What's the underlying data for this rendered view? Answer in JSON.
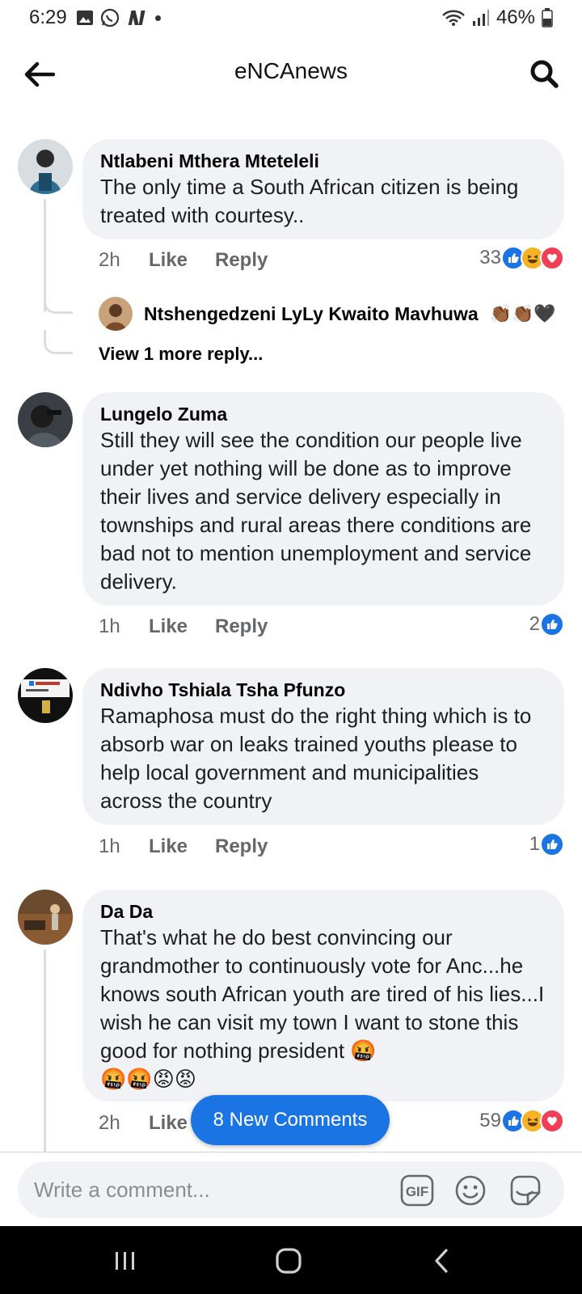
{
  "status": {
    "time": "6:29",
    "battery": "46%"
  },
  "header": {
    "title": "eNCAnews"
  },
  "comments": [
    {
      "author": "Ntlabeni Mthera Mteteleli",
      "text": "The only time a South African citizen is being treated with courtesy..",
      "time": "2h",
      "like": "Like",
      "reply": "Reply",
      "reaction_count": "33",
      "reactions": [
        "like-icon",
        "haha-icon",
        "love-icon"
      ],
      "reply_preview": {
        "author": "Ntshengedzeni LyLy Kwaito Mavhuwa",
        "emoji": "👏🏾👏🏾🖤"
      },
      "view_more": "View 1 more reply..."
    },
    {
      "author": "Lungelo Zuma",
      "text": "Still they will see the condition our people live under yet nothing will be done as to improve their lives and service delivery especially in townships and rural areas there conditions are bad not to mention unemployment and service delivery.",
      "time": "1h",
      "like": "Like",
      "reply": "Reply",
      "reaction_count": "2",
      "reactions": [
        "like-icon"
      ]
    },
    {
      "author": "Ndivho Tshiala Tsha Pfunzo",
      "text": "Ramaphosa must do the right thing which is to absorb war on leaks trained youths please to help local government and municipalities across the country",
      "time": "1h",
      "like": "Like",
      "reply": "Reply",
      "reaction_count": "1",
      "reactions": [
        "like-icon"
      ]
    },
    {
      "author": "Da Da",
      "text": "That's what he do best convincing our grandmother to continuously vote for Anc...he knows south African youth are tired of his lies...I wish he can visit my town I want to stone this good for nothing president 🤬",
      "emoji_line": "🤬🤬😡😡",
      "time": "2h",
      "like": "Like",
      "reaction_count": "59",
      "reactions": [
        "like-icon",
        "haha-icon",
        "love-icon"
      ]
    }
  ],
  "new_comments_button": "8 New Comments",
  "composer": {
    "placeholder": "Write a comment...",
    "gif_label": "GIF"
  },
  "colors": {
    "accent": "#1b74e4",
    "bubble": "#f0f2f5",
    "secondary_text": "#65676b",
    "love": "#f33e58",
    "haha": "#f7b125"
  }
}
